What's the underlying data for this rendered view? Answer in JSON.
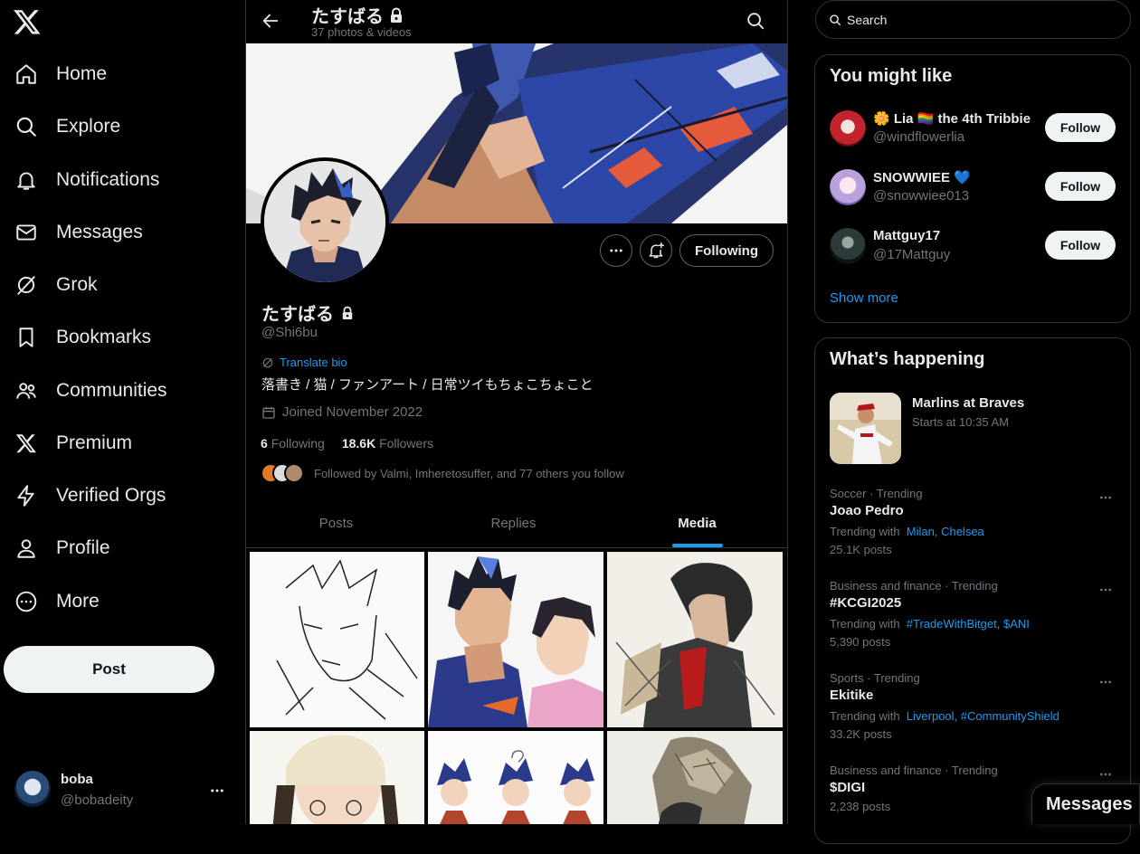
{
  "sidebar": {
    "nav": [
      {
        "label": "Home",
        "icon": "home-icon"
      },
      {
        "label": "Explore",
        "icon": "search-icon"
      },
      {
        "label": "Notifications",
        "icon": "bell-icon"
      },
      {
        "label": "Messages",
        "icon": "envelope-icon"
      },
      {
        "label": "Grok",
        "icon": "grok-icon"
      },
      {
        "label": "Bookmarks",
        "icon": "bookmark-icon"
      },
      {
        "label": "Communities",
        "icon": "people-icon"
      },
      {
        "label": "Premium",
        "icon": "x-logo-icon"
      },
      {
        "label": "Verified Orgs",
        "icon": "lightning-icon"
      },
      {
        "label": "Profile",
        "icon": "person-icon"
      },
      {
        "label": "More",
        "icon": "more-circle-icon"
      }
    ],
    "post_label": "Post",
    "account": {
      "name": "boba",
      "handle": "@bobadeity"
    }
  },
  "header": {
    "title": "たすばる",
    "subtitle": "37 photos & videos"
  },
  "profile": {
    "name": "たすばる",
    "handle": "@Shi6bu",
    "translate_label": "Translate bio",
    "bio": "落書き / 猫 / ファンアート / 日常ツイもちょこちょこと",
    "joined": "Joined November 2022",
    "following_count": "6",
    "following_label": "Following",
    "followers_count": "18.6K",
    "followers_label": "Followers",
    "followed_by": "Followed by Valmi, Imheretosuffer, and 77 others you follow",
    "follow_state_label": "Following"
  },
  "tabs": [
    {
      "label": "Posts"
    },
    {
      "label": "Replies"
    },
    {
      "label": "Media"
    }
  ],
  "active_tab": "Media",
  "right": {
    "search_placeholder": "Search",
    "you_might_like": {
      "title": "You might like",
      "users": [
        {
          "name": "🌼 Lia 🏳️‍🌈 the 4th Tribbie",
          "handle": "@windflowerlia",
          "button": "Follow"
        },
        {
          "name": "SNOWWIEE 💙",
          "handle": "@snowwiee013",
          "button": "Follow"
        },
        {
          "name": "Mattguy17",
          "handle": "@17Mattguy",
          "button": "Follow"
        }
      ],
      "show_more": "Show more"
    },
    "whats_happening": {
      "title": "What’s happening",
      "event": {
        "title": "Marlins at Braves",
        "time": "Starts at 10:35 AM"
      },
      "trends": [
        {
          "context": "Soccer · Trending",
          "title": "Joao Pedro",
          "with_prefix": "Trending with",
          "with": "Milan, Chelsea",
          "count": "25.1K posts"
        },
        {
          "context": "Business and finance · Trending",
          "title": "#KCGI2025",
          "with_prefix": "Trending with",
          "with": "#TradeWithBitget, $ANI",
          "count": "5,390 posts"
        },
        {
          "context": "Sports · Trending",
          "title": "Ekitike",
          "with_prefix": "Trending with",
          "with": "Liverpool, #CommunityShield",
          "count": "33.2K posts"
        },
        {
          "context": "Business and finance · Trending",
          "title": "$DIGI",
          "with_prefix": "",
          "with": "",
          "count": "2,238 posts"
        }
      ]
    }
  },
  "messages_drawer": {
    "label": "Messages"
  },
  "colors": {
    "accent": "#1d9bf0",
    "background": "#000000",
    "border": "#2f3336",
    "muted": "#71767b",
    "text": "#e7e9ea"
  }
}
